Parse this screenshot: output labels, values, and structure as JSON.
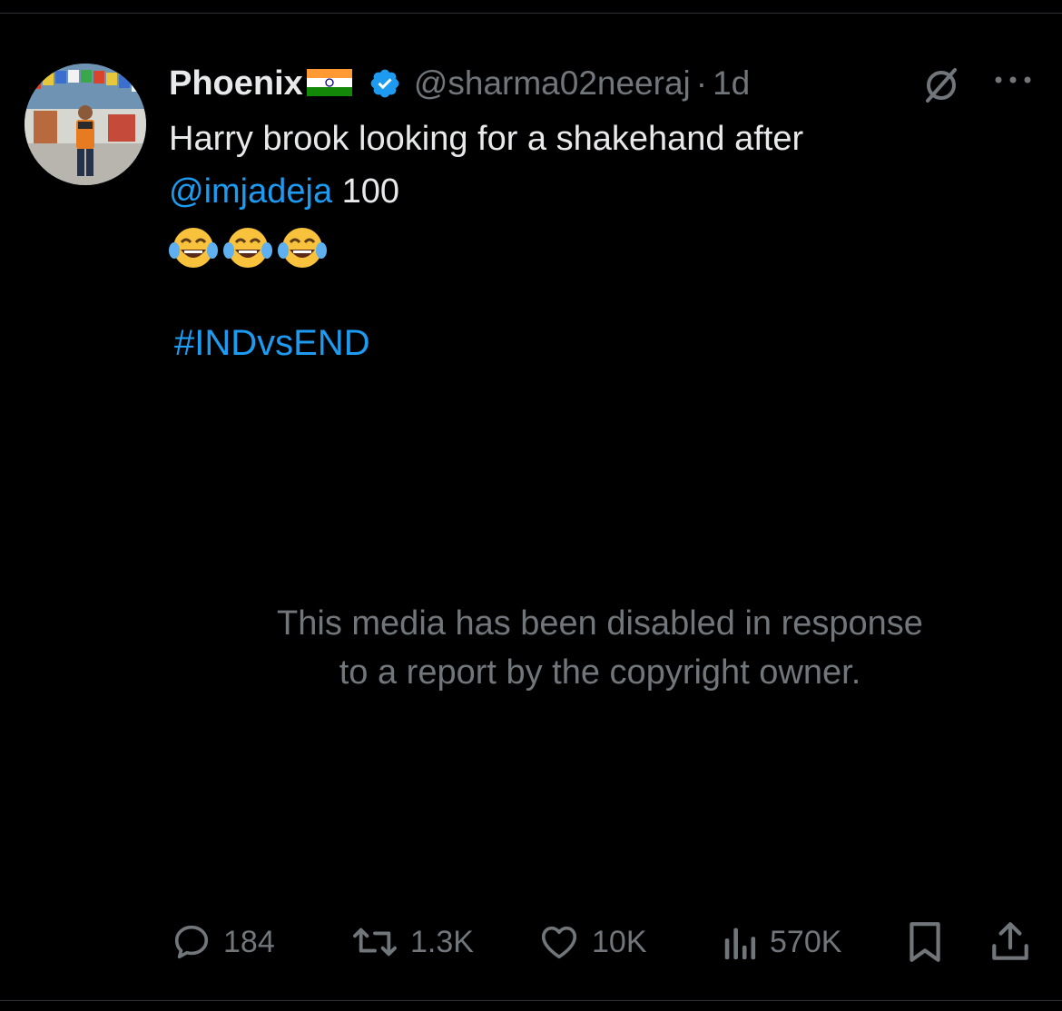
{
  "tweet": {
    "display_name": "Phoenix",
    "handle": "@sharma02neeraj",
    "separator": "·",
    "time": "1d",
    "text_line1": "Harry brook looking for a shakehand after",
    "mention": "@imjadeja",
    "text_after_mention": " 100",
    "emojis": [
      "😂",
      "😂",
      "😂"
    ],
    "hashtag": "#INDvsEND"
  },
  "media_notice": {
    "line1": "This media has been disabled in response",
    "line2": "to a report by the copyright owner."
  },
  "actions": {
    "replies": "184",
    "reposts": "1.3K",
    "likes": "10K",
    "views": "570K"
  },
  "icons": {
    "verified": "verified-badge-icon",
    "flag": "india-flag-icon",
    "grok": "grok-icon",
    "more": "more-options-icon",
    "reply": "reply-icon",
    "repost": "repost-icon",
    "like": "heart-icon",
    "views": "views-chart-icon",
    "bookmark": "bookmark-icon",
    "share": "share-icon"
  },
  "colors": {
    "background": "#000000",
    "text": "#e7e9ea",
    "muted": "#71767b",
    "link": "#1d9bf0"
  }
}
